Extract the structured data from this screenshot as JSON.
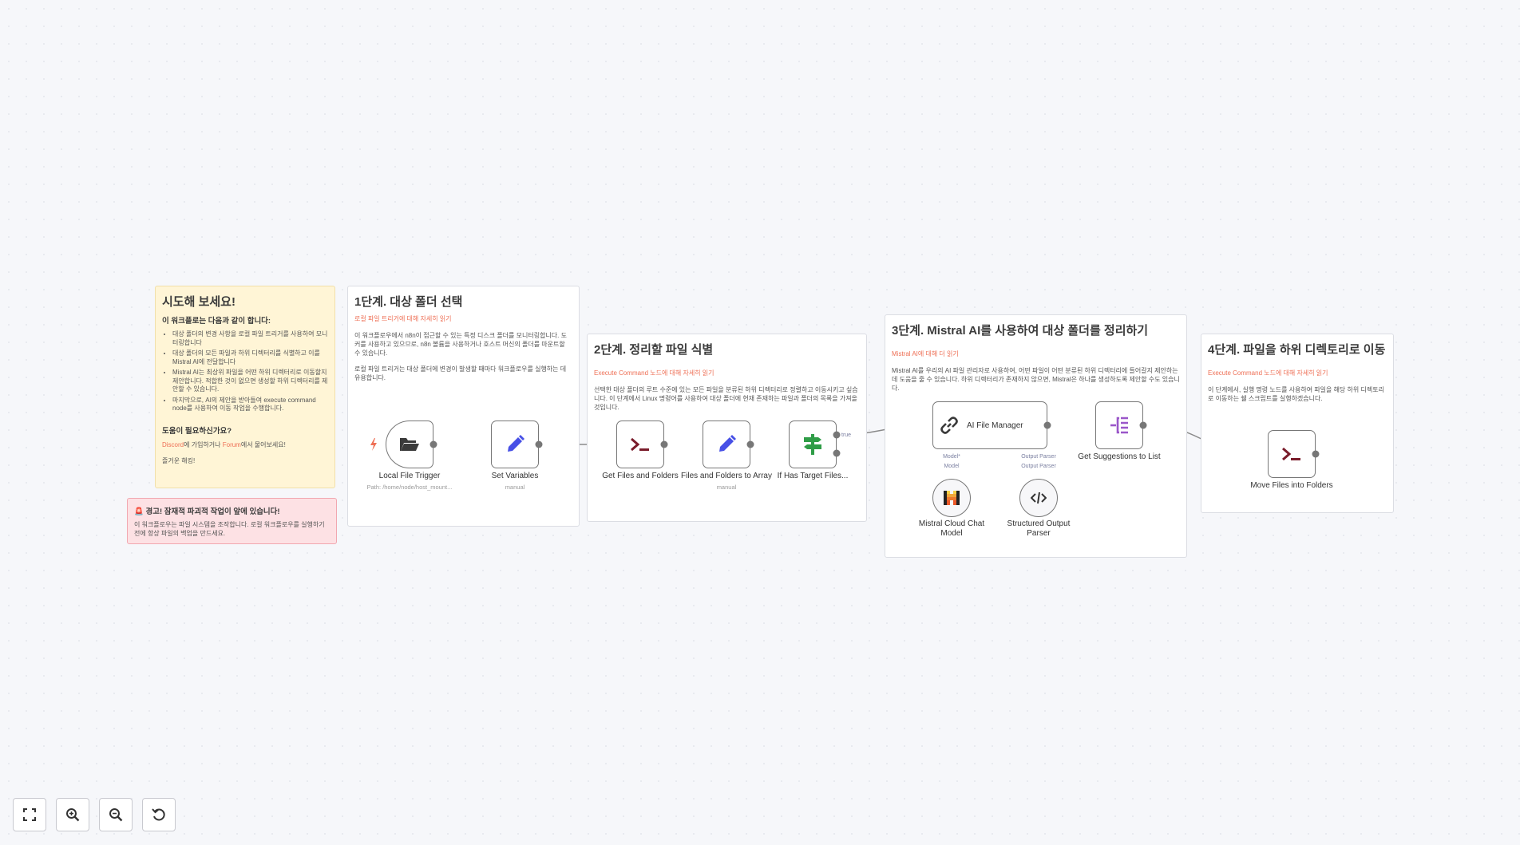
{
  "notes": {
    "intro": {
      "title": "시도해 보세요!",
      "subtitle": "이 워크플로는 다음과 같이 합니다:",
      "items": [
        "대상 폴더의 변경 사항을 로컬 파일 트리거를 사용하여 모니터링합니다",
        "대상 폴더의 모든 파일과 하위 디렉터리를 식별하고 이를 Mistral AI에 전달합니다",
        "Mistral AI는 최상위 파일을 어떤 하위 디렉터리로 이동할지 제안합니다. 적합한 것이 없으면 생성할 하위 디렉터리를 제안할 수 있습니다.",
        "마지막으로, AI의 제안을 받아들여 execute command node를 사용하여 이동 작업을 수행합니다."
      ],
      "help_title": "도움이 필요하신가요?",
      "help_link1": "Discord",
      "help_mid": "에 가입하거나 ",
      "help_link2": "Forum",
      "help_end": "에서 물어보세요!",
      "closing": "즐거운 해킹!"
    },
    "warning": {
      "title": "🚨 경고! 잠재적 파괴적 작업이 앞에 있습니다!",
      "body": "이 워크플로우는 파일 시스템을 조작합니다. 로컬 워크플로우를 실행하기 전에 항상 파일의 백업을 만드세요."
    },
    "step1": {
      "title": "1단계. 대상 폴더 선택",
      "link": "로컬 파일 트리거에 대해 자세히 읽기",
      "p1": "이 워크플로우에서 n8n이 접근할 수 있는 특정 디스크 폴더를 모니터링합니다. 도커를 사용하고 있으므로, n8n 볼륨을 사용하거나 호스트 머신의 폴더를 마운트할 수 있습니다.",
      "p2": "로컬 파일 트리거는 대상 폴더에 변경이 발생할 때마다 워크플로우를 실행하는 데 유용합니다."
    },
    "step2": {
      "title": "2단계. 정리할 파일 식별",
      "link": "Execute Command 노드에 대해 자세히 읽기",
      "p1": "선택한 대상 폴더의 루트 수준에 있는 모든 파일을 분류된 하위 디렉터리로 정렬하고 이동시키고 싶습니다. 이 단계에서 Linux 명령어를 사용하여 대상 폴더에 현재 존재하는 파일과 폴더의 목록을 가져올 것입니다."
    },
    "step3": {
      "title": "3단계. Mistral AI를 사용하여 대상 폴더를 정리하기",
      "link": "Mistral AI에 대해 더 읽기",
      "p1": "Mistral AI를 우리의 AI 파일 관리자로 사용하여, 어떤 파일이 어떤 분류된 하위 디렉터리에 들어갈지 제안하는 데 도움을 줄 수 있습니다. 하위 디렉터리가 존재하지 않으면, Mistral은 하나를 생성하도록 제안할 수도 있습니다."
    },
    "step4": {
      "title": "4단계. 파일을 하위 디렉토리로 이동",
      "link": "Execute Command 노드에 대해 자세히 읽기",
      "p1": "이 단계에서, 실행 명령 노드를 사용하여 파일을 해당 하위 디렉토리로 이동하는 쉘 스크립트를 실행하겠습니다."
    }
  },
  "nodes": {
    "local_file_trigger": {
      "label": "Local File Trigger",
      "sub": "Path: /home/node/host_mount...",
      "icon": "folder-open-icon"
    },
    "set_variables": {
      "label": "Set Variables",
      "sub": "manual",
      "icon": "pencil-icon"
    },
    "get_files": {
      "label": "Get Files and Folders",
      "icon": "terminal-icon"
    },
    "files_to_array": {
      "label": "Files and Folders to Array",
      "sub": "manual",
      "icon": "pencil-icon"
    },
    "if_target": {
      "label": "If Has Target Files...",
      "icon": "if-signpost-icon",
      "true_label": "true"
    },
    "ai_file_manager": {
      "label": "AI File Manager",
      "icon": "link-chain-icon",
      "port_model": "Model*",
      "port_parser": "Output Parser"
    },
    "get_suggestions": {
      "label": "Get Suggestions to List",
      "icon": "split-out-icon"
    },
    "move_files": {
      "label": "Move Files into Folders",
      "icon": "terminal-icon"
    },
    "mistral_model": {
      "label": "Mistral Cloud Chat Model",
      "port": "Model",
      "icon": "mistral-logo-icon"
    },
    "output_parser": {
      "label": "Structured Output Parser",
      "port": "Output Parser",
      "icon": "code-brackets-icon"
    }
  },
  "colors": {
    "pencil": "#4750e6",
    "terminal": "#7a1c2b",
    "if_node": "#2f9d47",
    "split": "#9a57c9",
    "link_accent": "#ee6f55"
  },
  "controls": [
    "fit-view-icon",
    "zoom-in-icon",
    "zoom-out-icon",
    "reset-zoom-icon"
  ]
}
